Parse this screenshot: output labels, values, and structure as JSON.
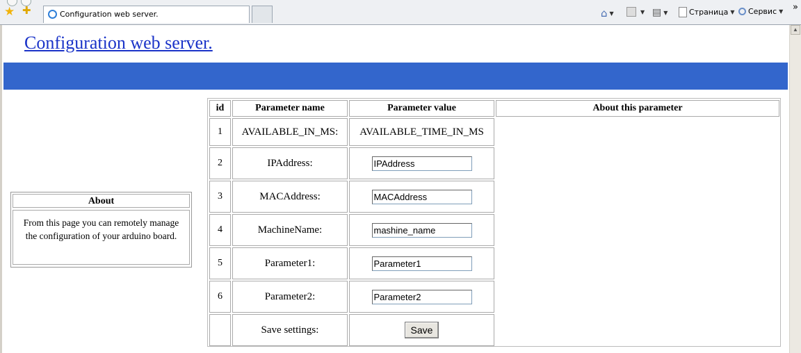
{
  "browser": {
    "tab_title": "Configuration web server.",
    "page_menu": "Страница",
    "tools_menu": "Сервис",
    "more": "»"
  },
  "page": {
    "title": "Configuration web server.",
    "banner_color": "#3366cc"
  },
  "about": {
    "heading": "About",
    "text": "From this page you can remotely manage the configuration of your arduino board."
  },
  "table": {
    "headers": {
      "id": "id",
      "name": "Parameter name",
      "value": "Parameter value",
      "about": "About this parameter"
    },
    "rows": [
      {
        "id": "1",
        "name": "AVAILABLE_IN_MS:",
        "value": "AVAILABLE_TIME_IN_MS"
      },
      {
        "id": "2",
        "name": "IPAddress:",
        "value": "IPAddress"
      },
      {
        "id": "3",
        "name": "MACAddress:",
        "value": "MACAddress"
      },
      {
        "id": "4",
        "name": "MachineName:",
        "value": "mashine_name"
      },
      {
        "id": "5",
        "name": "Parameter1:",
        "value": "Parameter1"
      },
      {
        "id": "6",
        "name": "Parameter2:",
        "value": "Parameter2"
      }
    ],
    "save_label": "Save settings:",
    "save_button": "Save"
  }
}
